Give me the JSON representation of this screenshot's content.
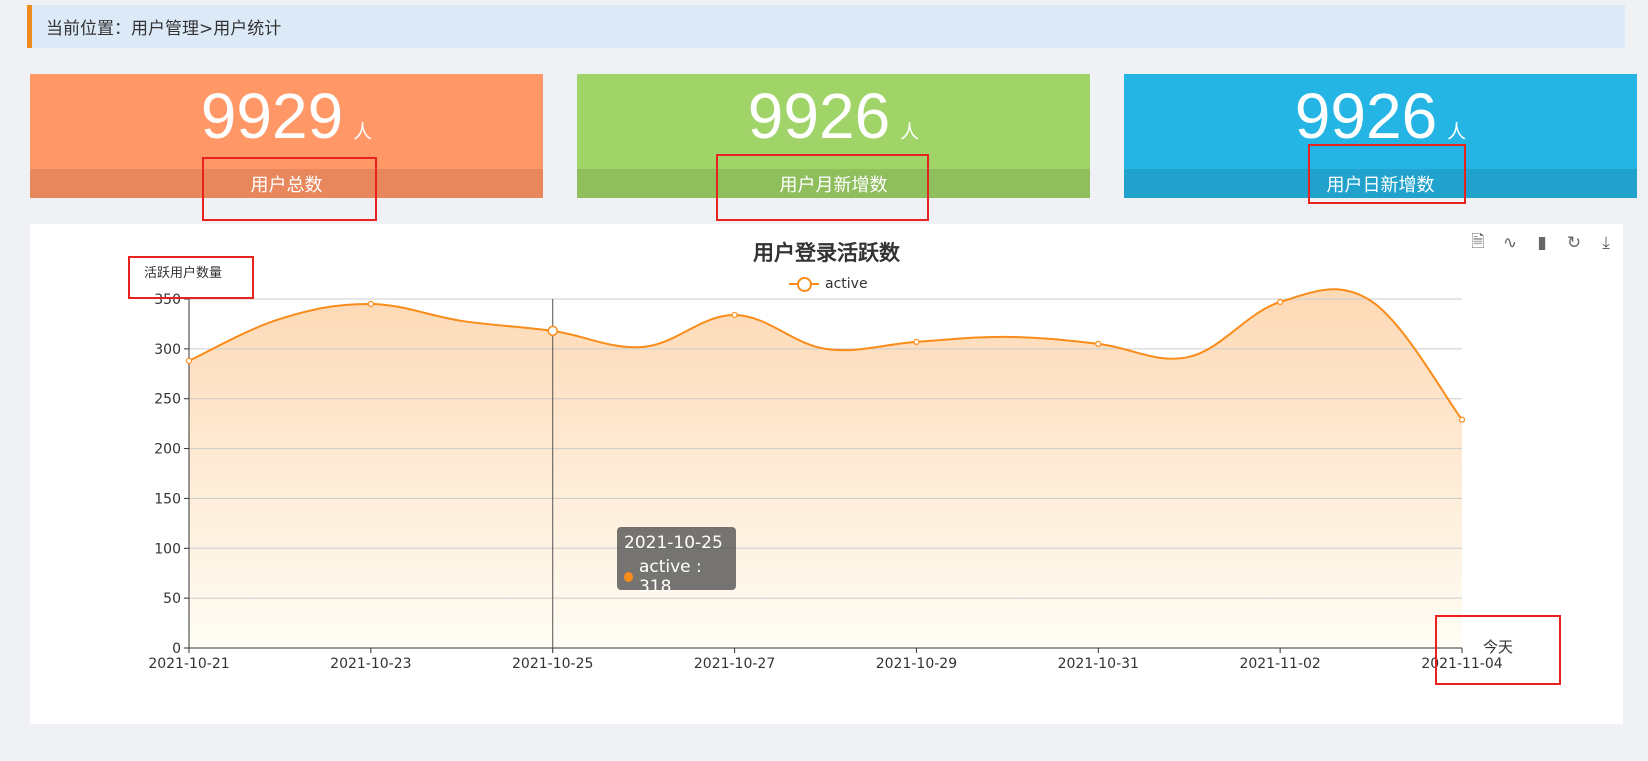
{
  "breadcrumb": "当前位置：用户管理>用户统计",
  "cards": [
    {
      "value": "9929",
      "unit": "人",
      "label": "用户总数"
    },
    {
      "value": "9926",
      "unit": "人",
      "label": "用户月新增数"
    },
    {
      "value": "9926",
      "unit": "人",
      "label": "用户日新增数"
    }
  ],
  "toolbox": [
    {
      "icon": "data-view-icon",
      "glyph": "🗎"
    },
    {
      "icon": "line-chart-icon",
      "glyph": "∿"
    },
    {
      "icon": "bar-chart-icon",
      "glyph": "▮"
    },
    {
      "icon": "restore-icon",
      "glyph": "↻"
    },
    {
      "icon": "download-icon",
      "glyph": "⤓"
    }
  ],
  "tooltip": {
    "date": "2021-10-25",
    "text": "active : 318"
  },
  "today_label": "今天",
  "colors": {
    "line": "#f98c1a",
    "accent": "#f08c1e",
    "highlight": "#e8221e"
  },
  "chart_data": {
    "type": "line",
    "title": "用户登录活跃数",
    "ylabel": "活跃用户数量",
    "legend": [
      "active"
    ],
    "legend_position": "top-center",
    "ylim": [
      0,
      350
    ],
    "yticks": [
      0,
      50,
      100,
      150,
      200,
      250,
      300,
      350
    ],
    "xtick_labels": [
      "2021-10-21",
      "2021-10-23",
      "2021-10-25",
      "2021-10-27",
      "2021-10-29",
      "2021-10-31",
      "2021-11-02",
      "2021-11-04"
    ],
    "grid": true,
    "smooth": true,
    "area": true,
    "series": [
      {
        "name": "active",
        "x": [
          "2021-10-21",
          "2021-10-22",
          "2021-10-23",
          "2021-10-24",
          "2021-10-25",
          "2021-10-26",
          "2021-10-27",
          "2021-10-28",
          "2021-10-29",
          "2021-10-30",
          "2021-10-31",
          "2021-11-01",
          "2021-11-02",
          "2021-11-03",
          "2021-11-04"
        ],
        "values": [
          288,
          330,
          345,
          328,
          318,
          302,
          334,
          300,
          307,
          312,
          305,
          292,
          347,
          348,
          229
        ]
      }
    ]
  }
}
